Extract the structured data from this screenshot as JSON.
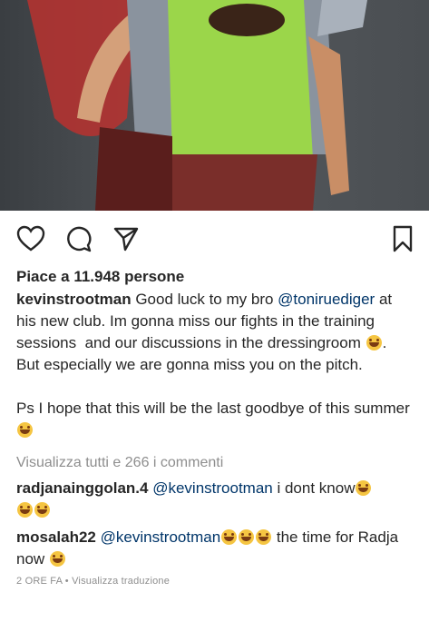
{
  "post": {
    "likes_text": "Piace a 11.948 persone",
    "caption": {
      "username": "kevinstrootman",
      "text_1": " Good luck to my bro ",
      "mention": "@toniruediger",
      "text_2": " at his new club. Im gonna miss our fights in the training sessions  and our discussions in the dressingroom ",
      "text_3": ". But especially we are gonna miss you on the pitch.\n\nPs I hope that this will be the last goodbye of this summer"
    },
    "view_all_comments": "Visualizza tutti e 266 i commenti",
    "comments": [
      {
        "username": "radjanainggolan.4",
        "mention": "@kevinstrootman",
        "text": " i dont know"
      },
      {
        "username": "mosalah22",
        "mention": "@kevinstrootman",
        "text_1": " the time for Radja now "
      }
    ],
    "timestamp": "2 ore fa",
    "separator": " • ",
    "translate_label": "Visualizza traduzione"
  },
  "icons": {
    "like": "heart-outline-icon",
    "comment": "comment-bubble-icon",
    "share": "paper-plane-icon",
    "save": "bookmark-icon"
  }
}
